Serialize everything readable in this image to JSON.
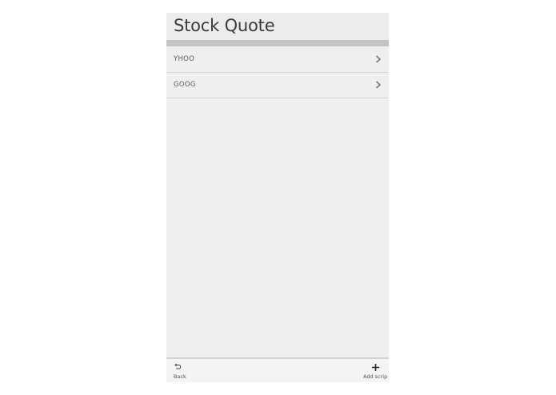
{
  "header": {
    "title": "Stock Quote"
  },
  "stocks": [
    {
      "symbol": "YHOO",
      "icon": "chevron-right-icon"
    },
    {
      "symbol": "GOOG",
      "icon": "chevron-right-icon"
    }
  ],
  "toolbar": {
    "back": {
      "label": "Back",
      "icon": "back-arrow-icon"
    },
    "add": {
      "label": "Add scrip",
      "icon": "plus-icon"
    }
  },
  "colors": {
    "background": "#efefef",
    "title_text": "#3a3a3a",
    "divider": "#c4c4c4"
  }
}
